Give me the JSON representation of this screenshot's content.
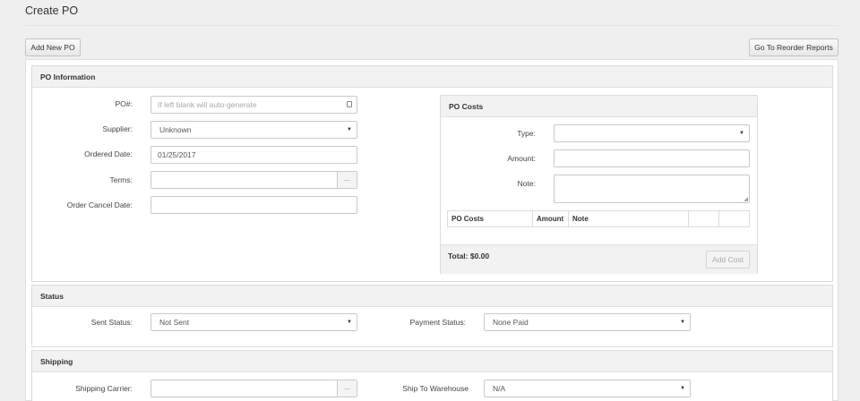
{
  "page": {
    "title": "Create PO"
  },
  "toolbar": {
    "add_new_po": "Add New PO",
    "go_to_reorder": "Go To Reorder Reports"
  },
  "po_info": {
    "heading": "PO Information",
    "po_number": {
      "label": "PO#:",
      "placeholder": "If left blank will auto-generate"
    },
    "supplier": {
      "label": "Supplier:",
      "value": "Unknown"
    },
    "ordered_date": {
      "label": "Ordered Date:",
      "value": "01/25/2017"
    },
    "terms": {
      "label": "Terms:",
      "value": "",
      "button": "..."
    },
    "order_cancel_date": {
      "label": "Order Cancel Date:",
      "value": ""
    }
  },
  "po_costs": {
    "heading": "PO Costs",
    "type_label": "Type:",
    "amount_label": "Amount:",
    "note_label": "Note:",
    "columns": [
      "PO Costs",
      "Amount",
      "Note",
      "",
      ""
    ],
    "total": "Total: $0.00",
    "add_cost": "Add Cost"
  },
  "status": {
    "heading": "Status",
    "sent_status": {
      "label": "Sent Status:",
      "value": "Not Sent"
    },
    "payment_status": {
      "label": "Payment Status:",
      "value": "None Paid"
    }
  },
  "shipping": {
    "heading": "Shipping",
    "carrier": {
      "label": "Shipping Carrier:",
      "value": "",
      "button": "..."
    },
    "ship_to_warehouse": {
      "label": "Ship To Warehouse",
      "value": "N/A"
    }
  }
}
